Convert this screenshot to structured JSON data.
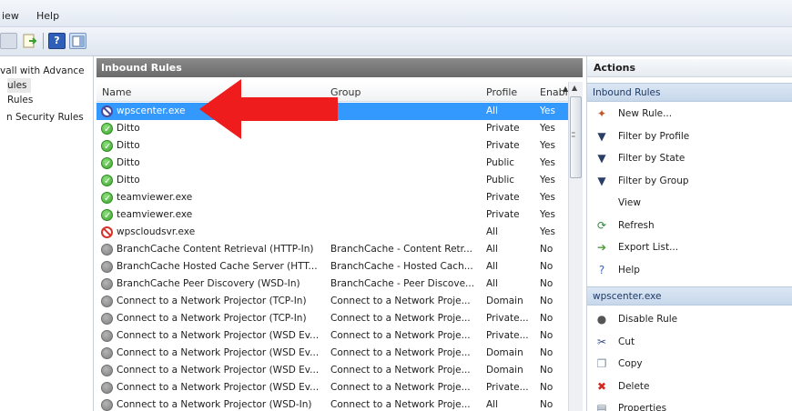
{
  "menu": {
    "view": "iew",
    "help": "Help"
  },
  "tree": {
    "items": [
      {
        "label": "vall with Advance",
        "selected": false
      },
      {
        "label": "ules",
        "selected": true
      },
      {
        "label": "Rules",
        "selected": false
      },
      {
        "label": "n Security Rules",
        "selected": false
      }
    ]
  },
  "center": {
    "title": "Inbound Rules",
    "columns": {
      "name": "Name",
      "group": "Group",
      "profile": "Profile",
      "enabled": "Enabl"
    },
    "rows": [
      {
        "icon": "blocksel",
        "name": "wpscenter.exe",
        "group": "",
        "profile": "All",
        "enabled": "Yes",
        "selected": true
      },
      {
        "icon": "allow",
        "name": "Ditto",
        "group": "",
        "profile": "Private",
        "enabled": "Yes"
      },
      {
        "icon": "allow",
        "name": "Ditto",
        "group": "",
        "profile": "Private",
        "enabled": "Yes"
      },
      {
        "icon": "allow",
        "name": "Ditto",
        "group": "",
        "profile": "Public",
        "enabled": "Yes"
      },
      {
        "icon": "allow",
        "name": "Ditto",
        "group": "",
        "profile": "Public",
        "enabled": "Yes"
      },
      {
        "icon": "allow",
        "name": "teamviewer.exe",
        "group": "",
        "profile": "Private",
        "enabled": "Yes"
      },
      {
        "icon": "allow",
        "name": "teamviewer.exe",
        "group": "",
        "profile": "Private",
        "enabled": "Yes"
      },
      {
        "icon": "block",
        "name": "wpscloudsvr.exe",
        "group": "",
        "profile": "All",
        "enabled": "Yes"
      },
      {
        "icon": "disabled",
        "name": "BranchCache Content Retrieval (HTTP-In)",
        "group": "BranchCache - Content Retr...",
        "profile": "All",
        "enabled": "No"
      },
      {
        "icon": "disabled",
        "name": "BranchCache Hosted Cache Server (HTT...",
        "group": "BranchCache - Hosted Cach...",
        "profile": "All",
        "enabled": "No"
      },
      {
        "icon": "disabled",
        "name": "BranchCache Peer Discovery (WSD-In)",
        "group": "BranchCache - Peer Discove...",
        "profile": "All",
        "enabled": "No"
      },
      {
        "icon": "disabled",
        "name": "Connect to a Network Projector (TCP-In)",
        "group": "Connect to a Network Proje...",
        "profile": "Domain",
        "enabled": "No"
      },
      {
        "icon": "disabled",
        "name": "Connect to a Network Projector (TCP-In)",
        "group": "Connect to a Network Proje...",
        "profile": "Private...",
        "enabled": "No"
      },
      {
        "icon": "disabled",
        "name": "Connect to a Network Projector (WSD Ev...",
        "group": "Connect to a Network Proje...",
        "profile": "Private...",
        "enabled": "No"
      },
      {
        "icon": "disabled",
        "name": "Connect to a Network Projector (WSD Ev...",
        "group": "Connect to a Network Proje...",
        "profile": "Domain",
        "enabled": "No"
      },
      {
        "icon": "disabled",
        "name": "Connect to a Network Projector (WSD Ev...",
        "group": "Connect to a Network Proje...",
        "profile": "Domain",
        "enabled": "No"
      },
      {
        "icon": "disabled",
        "name": "Connect to a Network Projector (WSD Ev...",
        "group": "Connect to a Network Proje...",
        "profile": "Private...",
        "enabled": "No"
      },
      {
        "icon": "disabled",
        "name": "Connect to a Network Projector (WSD-In)",
        "group": "Connect to a Network Proje...",
        "profile": "All",
        "enabled": "No"
      }
    ]
  },
  "actions": {
    "title": "Actions",
    "section1": "Inbound Rules",
    "items1": [
      {
        "icon": "new-rule-icon",
        "glyph": "✦",
        "color": "#c2572a",
        "label": "New Rule..."
      },
      {
        "icon": "filter-icon",
        "glyph": "▼",
        "color": "#2b3f66",
        "label": "Filter by Profile"
      },
      {
        "icon": "filter-icon",
        "glyph": "▼",
        "color": "#2b3f66",
        "label": "Filter by State"
      },
      {
        "icon": "filter-icon",
        "glyph": "▼",
        "color": "#2b3f66",
        "label": "Filter by Group"
      },
      {
        "icon": "",
        "glyph": "",
        "color": "#000000",
        "label": "View"
      },
      {
        "icon": "refresh-icon",
        "glyph": "⟳",
        "color": "#2e8a3a",
        "label": "Refresh"
      },
      {
        "icon": "export-icon",
        "glyph": "➔",
        "color": "#4f9a3a",
        "label": "Export List..."
      },
      {
        "icon": "help-icon",
        "glyph": "?",
        "color": "#3b63b5",
        "label": "Help"
      }
    ],
    "section2": "wpscenter.exe",
    "items2": [
      {
        "icon": "disable-rule-icon",
        "glyph": "●",
        "color": "#555555",
        "label": "Disable Rule"
      },
      {
        "icon": "cut-icon",
        "glyph": "✂",
        "color": "#3a4f8a",
        "label": "Cut"
      },
      {
        "icon": "copy-icon",
        "glyph": "❐",
        "color": "#7a8aa0",
        "label": "Copy"
      },
      {
        "icon": "delete-icon",
        "glyph": "✖",
        "color": "#d4281e",
        "label": "Delete"
      },
      {
        "icon": "properties-icon",
        "glyph": "▤",
        "color": "#6a7a90",
        "label": "Properties"
      }
    ]
  }
}
